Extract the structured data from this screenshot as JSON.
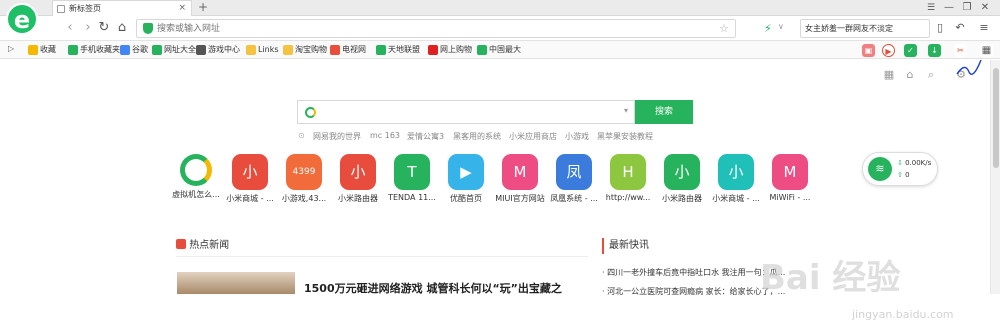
{
  "tabbar": {
    "tab_title": "新标签页",
    "new_tab": "+",
    "min": "—",
    "restore": "❐",
    "close": "✕",
    "menu": "☰"
  },
  "navbar": {
    "address_placeholder": "搜索或输入网址",
    "search_text": "女主娇羞一群网友不淡定",
    "search_caret": "∨"
  },
  "bookmarks": {
    "toggle": "▷",
    "items": [
      {
        "label": "收藏",
        "color": "#f5b800"
      },
      {
        "label": "手机收藏夹",
        "color": "#27b25e"
      },
      {
        "label": "谷歌",
        "color": "#4285f4"
      },
      {
        "label": "网址大全",
        "color": "#27b25e"
      },
      {
        "label": "游戏中心",
        "color": "#555555"
      },
      {
        "label": "Links",
        "color": "#f5c242"
      },
      {
        "label": "淘宝购物",
        "color": "#f5c242"
      },
      {
        "label": "电视网",
        "color": "#e94e3c"
      },
      {
        "label": "天地联盟",
        "color": "#27b25e"
      },
      {
        "label": "网上购物",
        "color": "#e02020"
      },
      {
        "label": "中国最大",
        "color": "#27b25e"
      }
    ]
  },
  "search": {
    "button": "搜索",
    "caret": "▾"
  },
  "hotwords": [
    "网易我的世界",
    "mc 163",
    "爱情公寓3",
    "黑客用的系统",
    "小米应用商店",
    "小游戏",
    "黑苹果安装教程"
  ],
  "apps": [
    {
      "label": "虚拟机怎么...",
      "glyph": "",
      "color": "#ffffff"
    },
    {
      "label": "小米商城 - ...",
      "glyph": "小",
      "color": "#e74c3c"
    },
    {
      "label": "小游戏,43...",
      "glyph": "4399",
      "color": "#f26b3a"
    },
    {
      "label": "小米路由器",
      "glyph": "小",
      "color": "#e74c3c"
    },
    {
      "label": "TENDA 11...",
      "glyph": "T",
      "color": "#27b25e"
    },
    {
      "label": "优酷首页",
      "glyph": "▶",
      "color": "#36b3e8"
    },
    {
      "label": "MIUI官方网站",
      "glyph": "M",
      "color": "#ee4d83"
    },
    {
      "label": "凤凰系统 - ...",
      "glyph": "凤",
      "color": "#3b7bdc"
    },
    {
      "label": "http://ww...",
      "glyph": "H",
      "color": "#8dc63f"
    },
    {
      "label": "小米路由器",
      "glyph": "小",
      "color": "#27b25e"
    },
    {
      "label": "小米商城 - ...",
      "glyph": "小",
      "color": "#20c0b8"
    },
    {
      "label": "MiWiFi - ...",
      "glyph": "M",
      "color": "#ee4d83"
    }
  ],
  "speed": {
    "down": "0.00K/s",
    "up": "0"
  },
  "news": {
    "section": "热点新闻",
    "headline": "1500万元砸进网络游戏 城管科长何以“玩”出宝藏之"
  },
  "flash": {
    "section": "最新快讯",
    "items": [
      "四川一老外撞车后竟中指吐口水 我注用一句：瓜...",
      "河北一公立医院可查网瘾病 家长：给家长心了，..."
    ]
  },
  "watermark": {
    "text": "Bai 经验",
    "sub": "jingyan.baidu.com"
  }
}
